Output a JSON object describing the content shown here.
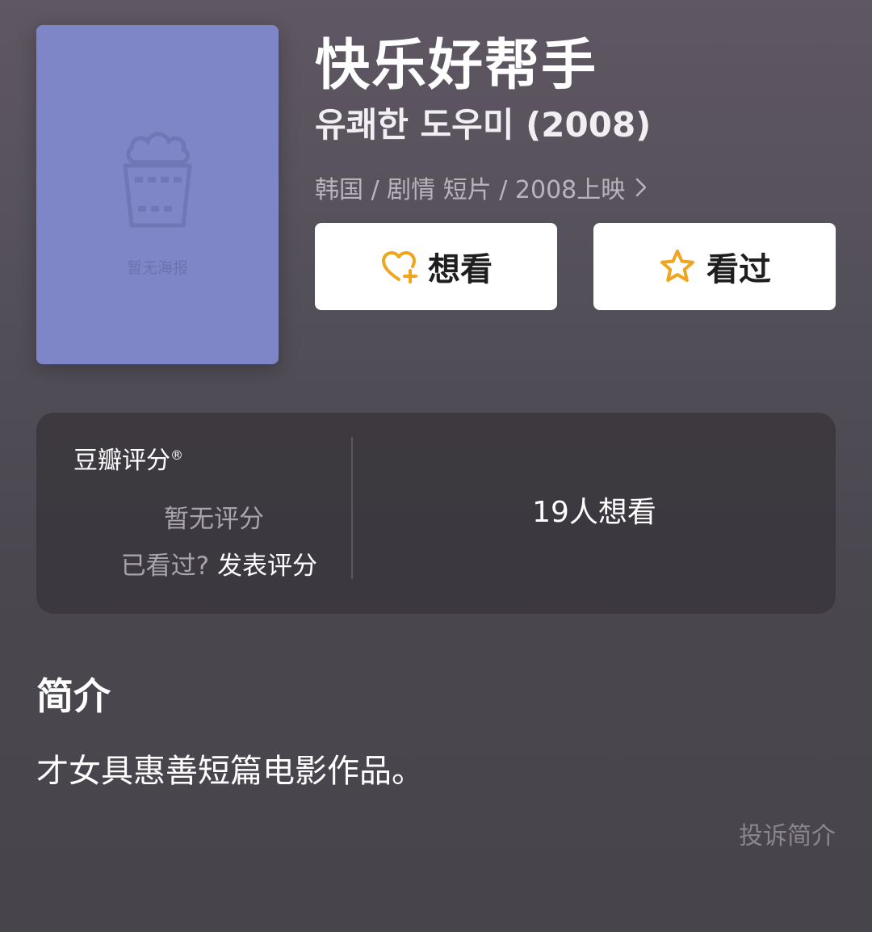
{
  "poster": {
    "placeholder_text": "暂无海报",
    "icon": "popcorn-bucket-icon",
    "bg_color": "#7f86c7"
  },
  "movie": {
    "title": "快乐好帮手",
    "original_title": "유쾌한 도우미 (2008)",
    "meta": "韩国 / 剧情 短片 / 2008上映",
    "meta_icon": "chevron-right-icon"
  },
  "actions": {
    "want_label": "想看",
    "want_icon": "heart-plus-icon",
    "seen_label": "看过",
    "seen_icon": "star-outline-icon",
    "icon_color": "#f0a51f"
  },
  "rating": {
    "brand": "豆瓣评分",
    "brand_mark": "®",
    "no_rating": "暂无评分",
    "seen_question": "已看过?",
    "post_rating": "发表评分",
    "want_count": "19人想看"
  },
  "intro": {
    "heading": "简介",
    "text": "才女具惠善短篇电影作品。",
    "report_label": "投诉简介"
  }
}
